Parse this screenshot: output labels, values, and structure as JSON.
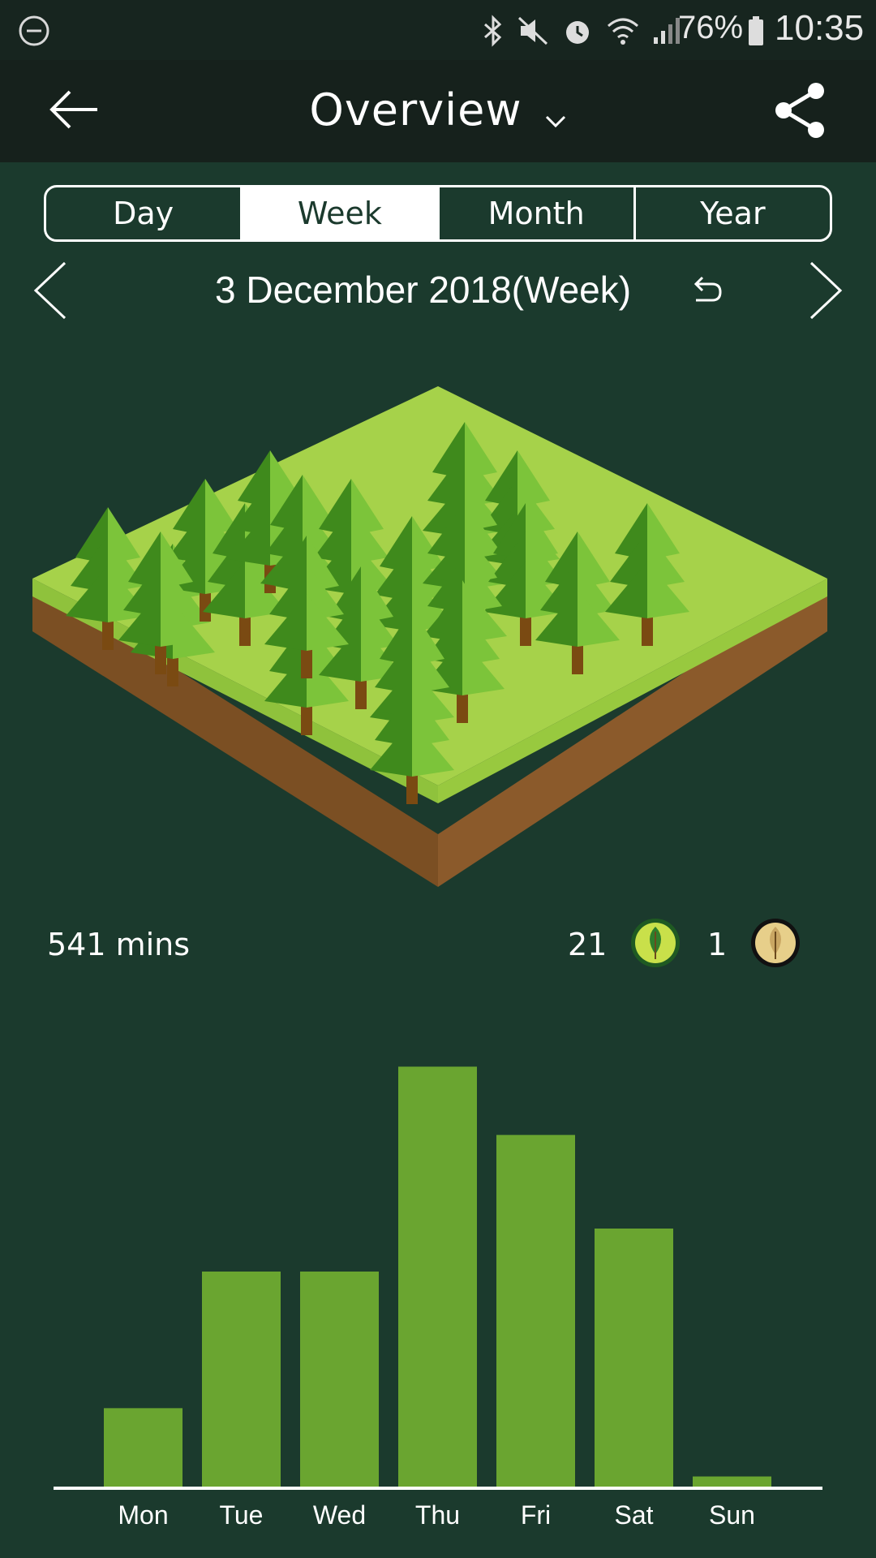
{
  "status_bar": {
    "battery": "76%",
    "time": "10:35",
    "icons": [
      "dnd-icon",
      "bluetooth-icon",
      "mute-icon",
      "alarm-icon",
      "wifi-icon",
      "signal-icon",
      "battery-icon"
    ]
  },
  "header": {
    "title": "Overview",
    "icons": [
      "back-arrow-icon",
      "chevron-down-icon",
      "share-icon"
    ]
  },
  "period_tabs": [
    {
      "label": "Day",
      "active": false
    },
    {
      "label": "Week",
      "active": true
    },
    {
      "label": "Month",
      "active": false
    },
    {
      "label": "Year",
      "active": false
    }
  ],
  "date_nav": {
    "label": "3 December 2018(Week)",
    "icons": [
      "chevron-left-icon",
      "undo-icon",
      "chevron-right-icon"
    ]
  },
  "summary": {
    "focus_time": "541 mins",
    "alive_trees": "21",
    "dead_trees": "1"
  },
  "colors": {
    "background": "#1b3a2d",
    "bar": "#6aa530",
    "tree_dark": "#3f8a1c",
    "tree_light": "#7cc43a",
    "grass": "#a8d44a"
  },
  "chart_data": {
    "type": "bar",
    "categories": [
      "Mon",
      "Tue",
      "Wed",
      "Thu",
      "Fri",
      "Sat",
      "Sun"
    ],
    "values": [
      31,
      85,
      85,
      166,
      139,
      102,
      4
    ],
    "ylim": [
      0,
      170
    ],
    "xlabel": "",
    "ylabel": "",
    "grid": false
  }
}
